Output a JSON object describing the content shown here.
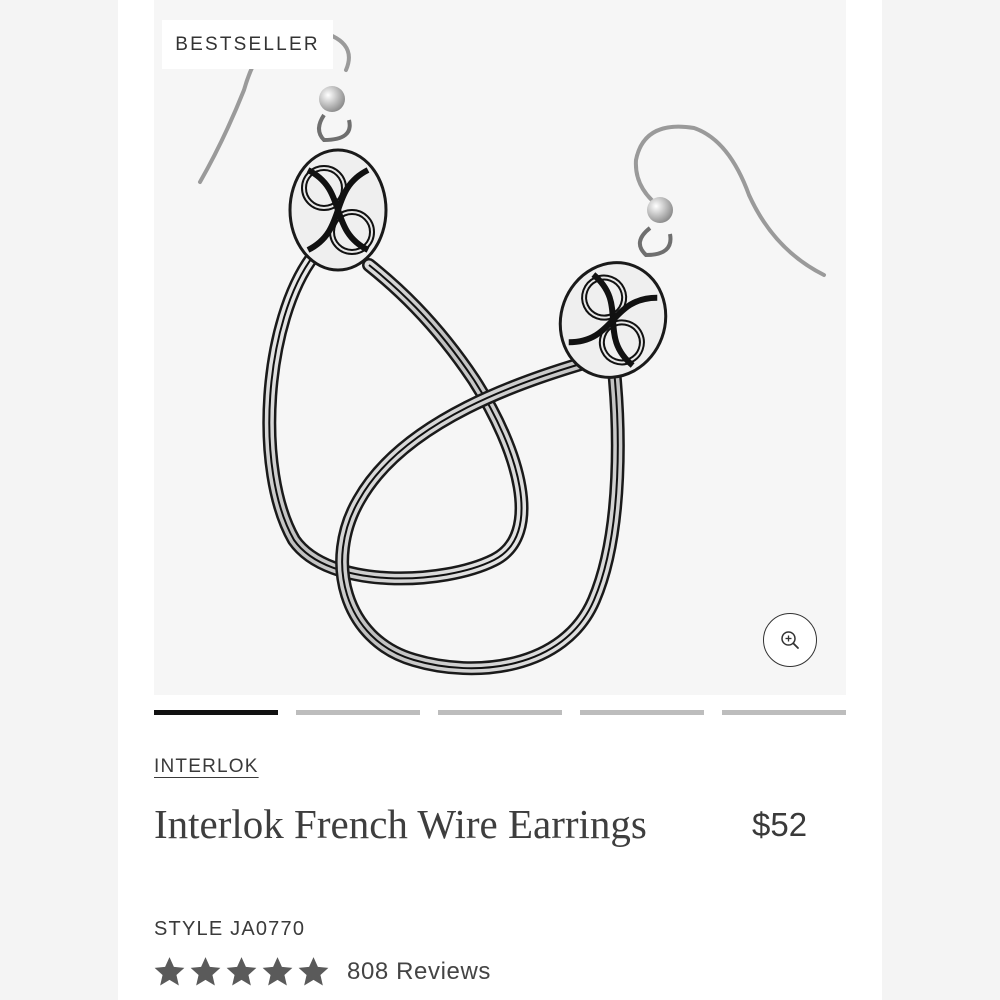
{
  "product": {
    "badge": "BESTSELLER",
    "collection": "INTERLOK",
    "title": "Interlok French Wire Earrings",
    "price": "$52",
    "style": "STYLE JA0770",
    "rating": 5,
    "reviews": "808 Reviews"
  },
  "gallery": {
    "image_count": 5,
    "active_index": 0,
    "zoom_icon": "zoom-in-icon"
  },
  "colors": {
    "pager_active": "#111111",
    "pager_inactive": "#bdbdbd",
    "star": "#5a5a5a"
  }
}
